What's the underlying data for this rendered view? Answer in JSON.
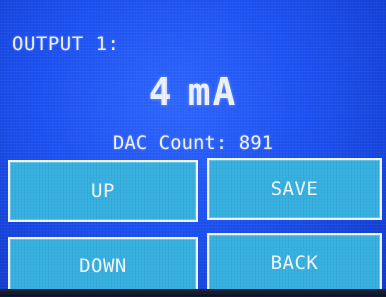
{
  "output": {
    "label": "OUTPUT 1:",
    "value": "4",
    "unit": "mA"
  },
  "dac": {
    "label": "DAC Count:",
    "value": "891"
  },
  "buttons": {
    "up": "UP",
    "save": "SAVE",
    "down": "DOWN",
    "back": "BACK"
  },
  "colors": {
    "background": "#1d52f2",
    "button_fill": "#36b0e0",
    "button_border": "#f1f6ff",
    "text": "#eef2ff"
  }
}
